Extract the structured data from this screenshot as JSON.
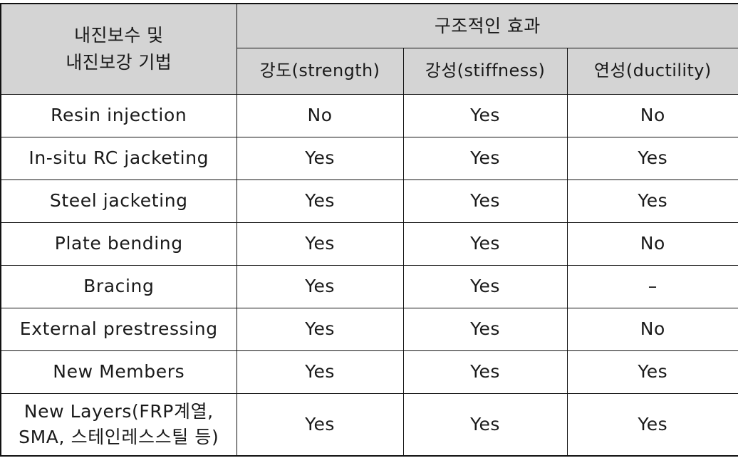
{
  "table": {
    "header": {
      "stub_label_line1": "내진보수 및",
      "stub_label_line2": "내진보강 기법",
      "group_label": "구조적인 효과",
      "subcolumns": [
        "강도(strength)",
        "강성(stiffness)",
        "연성(ductility)"
      ]
    },
    "rows": [
      {
        "technique": "Resin injection",
        "technique_line2": "",
        "strength": "No",
        "stiffness": "Yes",
        "ductility": "No"
      },
      {
        "technique": "In-situ RC jacketing",
        "technique_line2": "",
        "strength": "Yes",
        "stiffness": "Yes",
        "ductility": "Yes"
      },
      {
        "technique": "Steel jacketing",
        "technique_line2": "",
        "strength": "Yes",
        "stiffness": "Yes",
        "ductility": "Yes"
      },
      {
        "technique": "Plate bending",
        "technique_line2": "",
        "strength": "Yes",
        "stiffness": "Yes",
        "ductility": "No"
      },
      {
        "technique": "Bracing",
        "technique_line2": "",
        "strength": "Yes",
        "stiffness": "Yes",
        "ductility": "–"
      },
      {
        "technique": "External prestressing",
        "technique_line2": "",
        "strength": "Yes",
        "stiffness": "Yes",
        "ductility": "No"
      },
      {
        "technique": "New Members",
        "technique_line2": "",
        "strength": "Yes",
        "stiffness": "Yes",
        "ductility": "Yes"
      },
      {
        "technique": "New Layers(FRP계열,",
        "technique_line2": "SMA, 스테인레스스틸 등)",
        "strength": "Yes",
        "stiffness": "Yes",
        "ductility": "Yes"
      }
    ]
  },
  "colors": {
    "header_background": "#d4d4d4",
    "body_background": "#ffffff",
    "border": "#111111",
    "text": "#1a1a1a"
  }
}
